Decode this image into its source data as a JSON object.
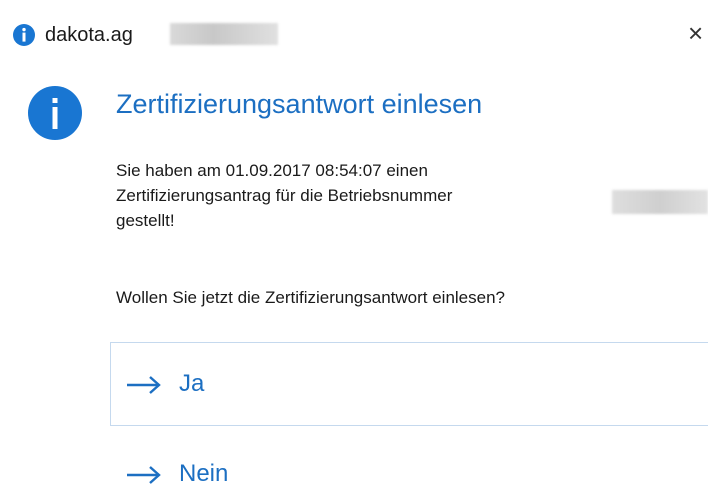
{
  "window": {
    "title": "dakota.ag",
    "close_glyph": "×"
  },
  "icons": {
    "title_icon": "info-icon",
    "main_icon": "info-icon",
    "command_arrow": "right-arrow-icon"
  },
  "colors": {
    "accent": "#1c6fc2",
    "icon_blue": "#1976d2",
    "border": "#c5d9ee",
    "text": "#1a1a1a"
  },
  "main": {
    "heading": "Zertifizierungsantwort einlesen",
    "message_lines": [
      "Sie haben am 01.09.2017 08:54:07 einen",
      "Zertifizierungsantrag für die Betriebsnummer",
      "gestellt!"
    ],
    "question": "Wollen Sie jetzt die Zertifizierungsantwort einlesen?"
  },
  "commands": [
    {
      "label": "Ja"
    },
    {
      "label": "Nein"
    }
  ]
}
